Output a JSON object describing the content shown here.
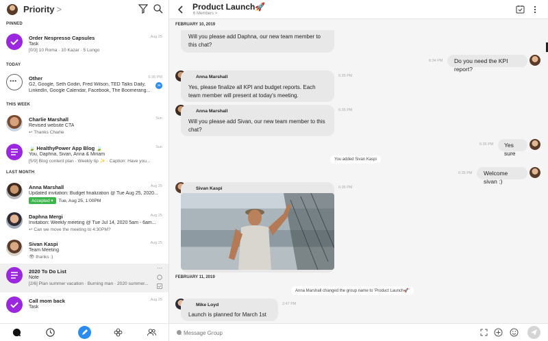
{
  "sidebar": {
    "title": "Priority",
    "title_chevron": ">",
    "sections": {
      "pinned": "PINNED",
      "today": "TODAY",
      "this_week": "THIS WEEK",
      "last_month": "LAST MONTH"
    },
    "items": [
      {
        "name": "Order Nespresso Capsules",
        "line1": "Task",
        "line2": "[0/3] 10 Roma · 10 Kazar · 5 Lungo",
        "time": "Aug 25"
      },
      {
        "name": "Other",
        "line1": "G2, Google, Seth Godin, Fred Wilson, TED Talks Daily,",
        "line2": "LinkedIn, Google Calendar, Facebook, The Boomerang...",
        "time": "6:36 PM",
        "badge": "26"
      },
      {
        "name": "Charlie Marshall",
        "line1": "Revised website CTA",
        "line2": "↩ Thanks Charlie",
        "time": "Sun"
      },
      {
        "name": "🍃 HealthyPower App Blog 🍃",
        "line1": "You, Daphna, Sivan, Anna & Miriam",
        "line2": "[5/9] Blog content plan · Weekly tip ✨ · Caption: Have you...",
        "time": "Sun"
      },
      {
        "name": "Anna Marshall",
        "line1": "Updated invitation: Budget finalization @ Tue Aug 25, 2020...",
        "accepted": "Accepted ▾",
        "line2": "Tue, Aug 25, 1:00PM",
        "time": "Aug 25"
      },
      {
        "name": "Daphna Mergi",
        "line1": "Invitation: Weekly meeting @ Tue Jul 14, 2020 5am - 6am...",
        "line2": "↩ Can we move the meeting to 4:30PM?",
        "time": "Aug 25"
      },
      {
        "name": "Sivan Kaspi",
        "line1": "Team Meeting",
        "line2": "👁 thanks :)",
        "time": "Aug 25"
      },
      {
        "name": "2020 To Do List",
        "line1": "Note",
        "line2": "[2/6] Plan summer vacation · Burning man · 2020 summer...",
        "time": "···"
      },
      {
        "name": "Call mom back",
        "line1": "Task",
        "line2": "",
        "time": "Aug 25"
      }
    ]
  },
  "chat": {
    "title": "Product Launch🚀",
    "members": "6 Members >",
    "input_placeholder": "Message Group",
    "date1": "FEBRUARY 10, 2019",
    "date2": "FEBRUARY 11, 2019",
    "messages": {
      "m1": "Will you please add Daphna, our new team member to this chat?",
      "m2": "Do you need the KPI report?",
      "m2_time": "6:34 PM",
      "m3_who": "Anna Marshall",
      "m3": "Yes, please finalize all KPI and budget reports. Each team member will present at today's meeting.",
      "m3_time": "6:35 PM",
      "m4_who": "Anna Marshall",
      "m4": "Will you please add Sivan, our new team member to this chat?",
      "m4_time": "6:35 PM",
      "m5": "Yes sure",
      "m5_time": "6:35 PM",
      "sys1": "You added Sivan Kaspi",
      "m6": "Welcome sivan :)",
      "m6_time": "6:35 PM",
      "m7_who": "Sivan Kaspi",
      "m7_time": "6:35 PM",
      "sys2": "Anna Marshall changed the group name to 'Product Launch🚀'",
      "m8_who": "Mike Loyd",
      "m8": "Launch is planned for March 1st",
      "m8_time": "2:47 PM"
    }
  },
  "colors": {
    "accent": "#2a8cf0",
    "purple": "#9b27e0",
    "green": "#3cb54a"
  }
}
